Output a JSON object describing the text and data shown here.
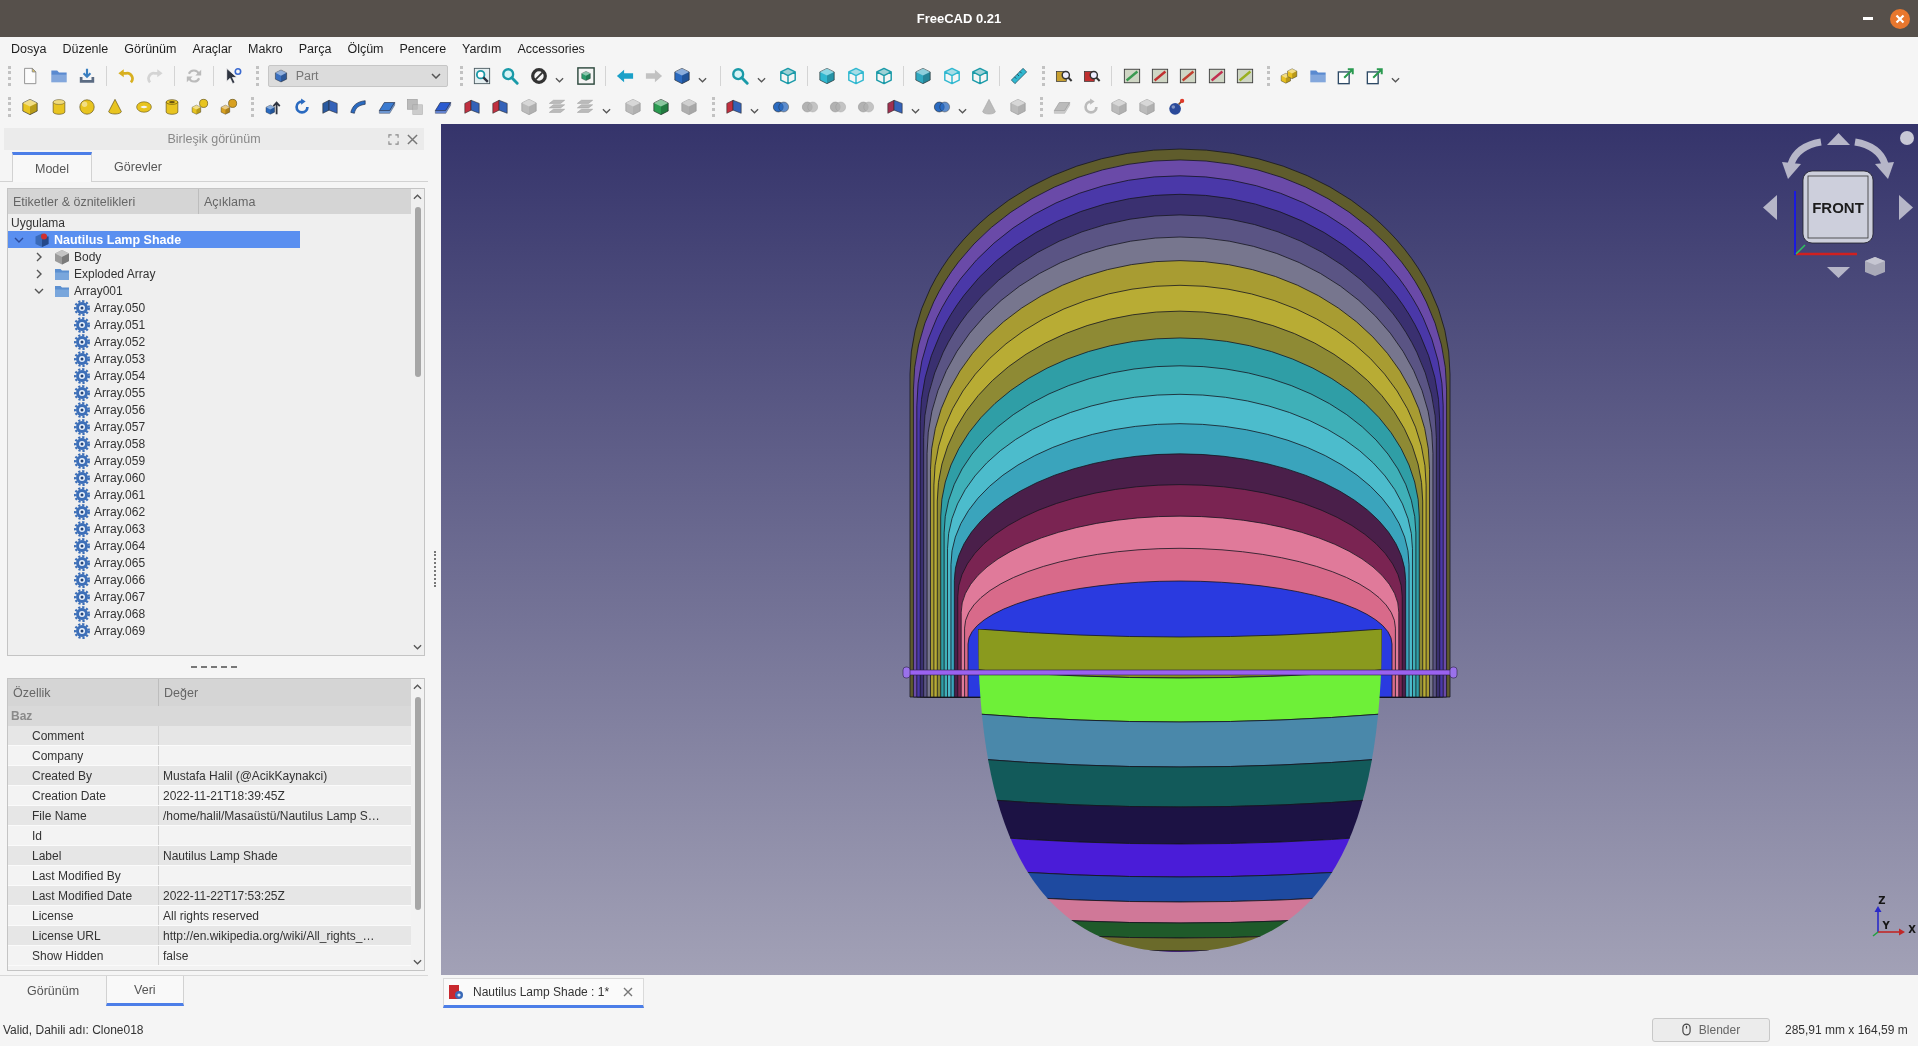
{
  "window": {
    "title": "FreeCAD 0.21"
  },
  "menu": [
    "Dosya",
    "Düzenle",
    "Görünüm",
    "Araçlar",
    "Makro",
    "Parça",
    "Ölçüm",
    "Pencere",
    "Yardım",
    "Accessories"
  ],
  "toolbars": [
    {
      "buttons": [
        {
          "disabled": false
        },
        {
          "disabled": false
        },
        {
          "disabled": false
        },
        {
          "disabled": false
        },
        {
          "disabled": true
        },
        {
          "disabled": true
        },
        {
          "disabled": false
        },
        {
          "disabled": false
        },
        {
          "disabled": false
        },
        {
          "disabled": false
        },
        {
          "disabled": false
        },
        {
          "disabled": false
        },
        {
          "disabled": true
        },
        {
          "disabled": false
        },
        {
          "disabled": false
        },
        {
          "disabled": false
        },
        {
          "disabled": false
        },
        {
          "disabled": false
        },
        {
          "disabled": false
        },
        {
          "disabled": false
        },
        {
          "disabled": false
        },
        {
          "disabled": false
        },
        {
          "disabled": false
        },
        {
          "disabled": false
        },
        {
          "disabled": false
        },
        {
          "disabled": false
        },
        {
          "disabled": false
        },
        {
          "disabled": false
        },
        {
          "disabled": false
        },
        {
          "disabled": false
        },
        {
          "disabled": false
        },
        {
          "disabled": false
        },
        {
          "disabled": false
        },
        {
          "disabled": false
        }
      ]
    },
    {
      "buttons": [
        {
          "disabled": false
        },
        {
          "disabled": false
        },
        {
          "disabled": false
        },
        {
          "disabled": false
        },
        {
          "disabled": false
        },
        {
          "disabled": false
        },
        {
          "disabled": false
        },
        {
          "disabled": false
        },
        {
          "disabled": false
        },
        {
          "disabled": false
        },
        {
          "disabled": false
        },
        {
          "disabled": false
        },
        {
          "disabled": false
        },
        {
          "disabled": true
        },
        {
          "disabled": false
        },
        {
          "disabled": false
        },
        {
          "disabled": false
        },
        {
          "disabled": true
        },
        {
          "disabled": true
        },
        {
          "disabled": true
        },
        {
          "disabled": true
        },
        {
          "disabled": false
        },
        {
          "disabled": true
        },
        {
          "disabled": false
        },
        {
          "disabled": false
        },
        {
          "disabled": true
        },
        {
          "disabled": true
        },
        {
          "disabled": true
        },
        {
          "disabled": false
        },
        {
          "disabled": false
        },
        {
          "disabled": true
        },
        {
          "disabled": true
        },
        {
          "disabled": true
        },
        {
          "disabled": true
        },
        {
          "disabled": true
        },
        {
          "disabled": true
        },
        {
          "disabled": false
        }
      ]
    }
  ],
  "workbench": {
    "value": "Part"
  },
  "combo_view": {
    "title": "Birleşik görünüm",
    "tabs": [
      {
        "label": "Model",
        "selected": true
      },
      {
        "label": "Görevler",
        "selected": false
      }
    ],
    "tree": {
      "columns": [
        "Etiketler & öznitelikleri",
        "Açıklama"
      ],
      "root": "Uygulama",
      "items": [
        {
          "label": "Nautilus Lamp Shade",
          "kind": "document",
          "expanded": true,
          "selected": true,
          "children": [
            {
              "label": "Body",
              "kind": "body",
              "expanded": false,
              "selected": false
            },
            {
              "label": "Exploded Array",
              "kind": "folder",
              "expanded": false,
              "selected": false
            },
            {
              "label": "Array001",
              "kind": "folder",
              "expanded": true,
              "selected": false,
              "children": [
                {
                  "label": "Array.050",
                  "kind": "array",
                  "selected": false
                },
                {
                  "label": "Array.051",
                  "kind": "array",
                  "selected": false
                },
                {
                  "label": "Array.052",
                  "kind": "array",
                  "selected": false
                },
                {
                  "label": "Array.053",
                  "kind": "array",
                  "selected": false
                },
                {
                  "label": "Array.054",
                  "kind": "array",
                  "selected": false
                },
                {
                  "label": "Array.055",
                  "kind": "array",
                  "selected": false
                },
                {
                  "label": "Array.056",
                  "kind": "array",
                  "selected": false
                },
                {
                  "label": "Array.057",
                  "kind": "array",
                  "selected": false
                },
                {
                  "label": "Array.058",
                  "kind": "array",
                  "selected": false
                },
                {
                  "label": "Array.059",
                  "kind": "array",
                  "selected": false
                },
                {
                  "label": "Array.060",
                  "kind": "array",
                  "selected": false
                },
                {
                  "label": "Array.061",
                  "kind": "array",
                  "selected": false
                },
                {
                  "label": "Array.062",
                  "kind": "array",
                  "selected": false
                },
                {
                  "label": "Array.063",
                  "kind": "array",
                  "selected": false
                },
                {
                  "label": "Array.064",
                  "kind": "array",
                  "selected": false
                },
                {
                  "label": "Array.065",
                  "kind": "array",
                  "selected": false
                },
                {
                  "label": "Array.066",
                  "kind": "array",
                  "selected": false
                },
                {
                  "label": "Array.067",
                  "kind": "array",
                  "selected": false
                },
                {
                  "label": "Array.068",
                  "kind": "array",
                  "selected": false
                },
                {
                  "label": "Array.069",
                  "kind": "array",
                  "selected": false
                }
              ]
            }
          ]
        }
      ]
    },
    "properties": {
      "columns": [
        "Özellik",
        "Değer"
      ],
      "groups": [
        {
          "name": "Baz",
          "rows": [
            {
              "name": "Comment"
            },
            {
              "name": "Company"
            },
            {
              "name": "Created By",
              "value": "Mustafa Halil (@AcikKaynakci)"
            },
            {
              "name": "Creation Date",
              "value": "2022-11-21T18:39:45Z"
            },
            {
              "name": "File Name",
              "value": "/home/halil/Masaüstü/Nautilus Lamp S…"
            },
            {
              "name": "Id"
            },
            {
              "name": "Label",
              "value": "Nautilus Lamp Shade"
            },
            {
              "name": "Last Modified By"
            },
            {
              "name": "Last Modified Date",
              "value": "2022-11-22T17:53:25Z"
            },
            {
              "name": "License",
              "value": "All rights reserved"
            },
            {
              "name": "License URL",
              "value": "http://en.wikipedia.org/wiki/All_rights_…"
            },
            {
              "name": "Show Hidden",
              "value": "false"
            }
          ]
        }
      ]
    },
    "panel_tabs": [
      {
        "label": "Görünüm",
        "selected": false
      },
      {
        "label": "Veri",
        "selected": true
      }
    ]
  },
  "view": {
    "navigation_cube": {
      "face": "FRONT"
    },
    "axis_labels": [
      "Z",
      "Y",
      "X"
    ]
  },
  "document_tabs": [
    {
      "label": "Nautilus Lamp Shade : 1*",
      "selected": true
    }
  ],
  "status_bar": {
    "message": "Valid, Dahili adı: Clone018",
    "navigation_style": "Blender",
    "dimensions": "285,91 mm x 164,59 m"
  }
}
